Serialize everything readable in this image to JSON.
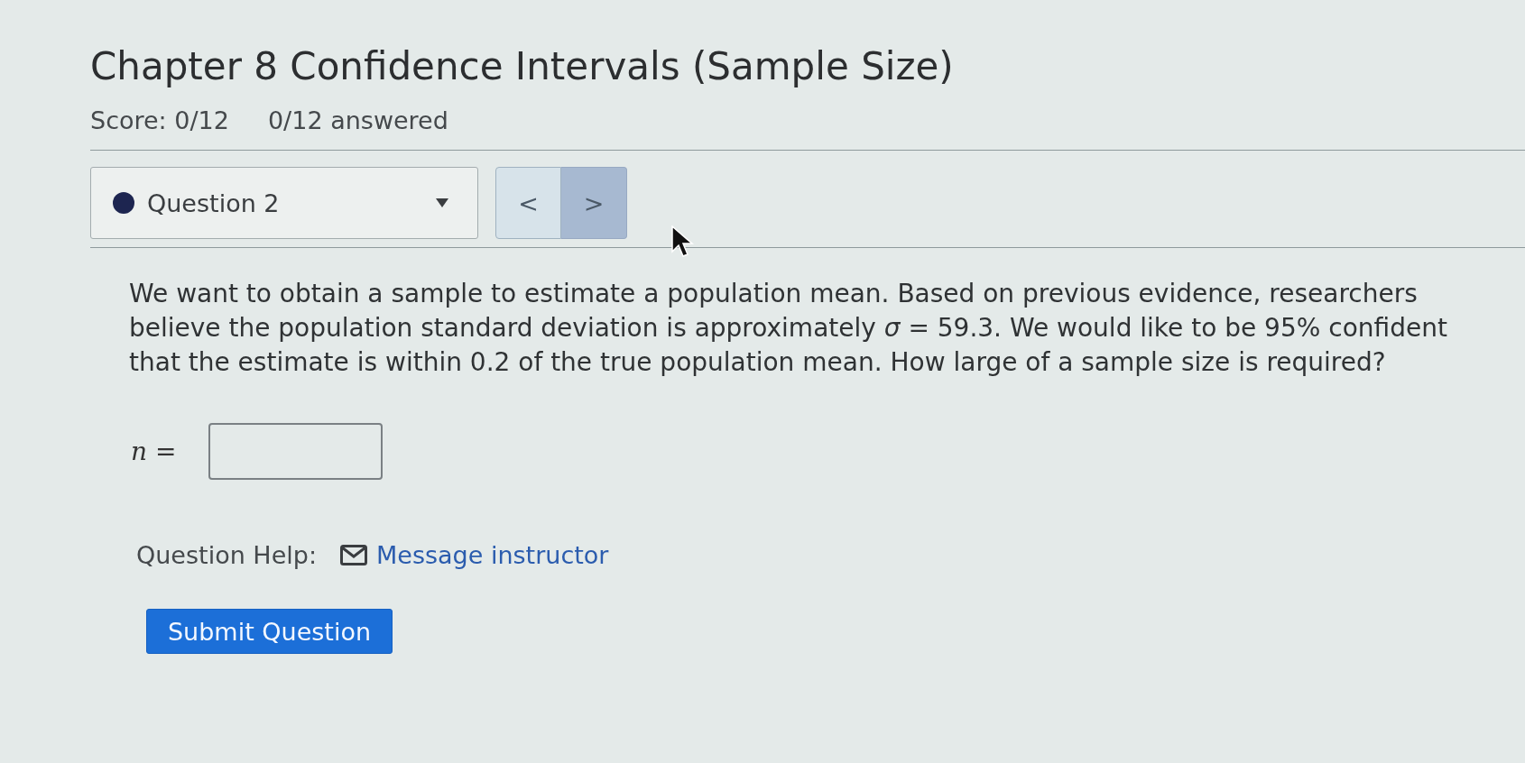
{
  "header": {
    "title": "Chapter 8 Confidence Intervals (Sample Size)",
    "score": "Score: 0/12",
    "answered": "0/12 answered"
  },
  "navigation": {
    "question_select": {
      "label": "Question 2"
    },
    "buttons": [
      {
        "label": "<",
        "highlighted": false
      },
      {
        "label": ">",
        "highlighted": true
      }
    ]
  },
  "question": {
    "text": "We want to obtain a sample to estimate a population mean. Based on previous evidence, researchers believe the population standard deviation is approximately *σ* = 59.3. We would like to be 95% confident that the estimate is within 0.2 of the true population mean. How large of a sample size is required?",
    "answer": {
      "label": "*n* ="
    },
    "help": {
      "label": "Question Help:",
      "link": "Message instructor"
    },
    "submit": "Submit Question"
  }
}
